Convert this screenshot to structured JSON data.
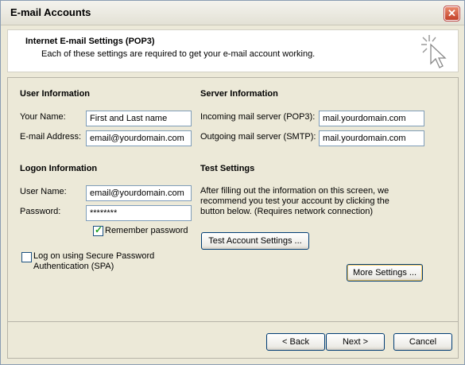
{
  "window": {
    "title": "E-mail Accounts"
  },
  "header": {
    "title": "Internet E-mail Settings (POP3)",
    "subtitle": "Each of these settings are required to get your e-mail account working."
  },
  "user_info": {
    "heading": "User Information",
    "name_label": "Your Name:",
    "name_value": "First and Last name",
    "email_label": "E-mail Address:",
    "email_value": "email@yourdomain.com"
  },
  "server_info": {
    "heading": "Server Information",
    "incoming_label": "Incoming mail server (POP3):",
    "incoming_value": "mail.yourdomain.com",
    "outgoing_label": "Outgoing mail server (SMTP):",
    "outgoing_value": "mail.yourdomain.com"
  },
  "logon_info": {
    "heading": "Logon Information",
    "username_label": "User Name:",
    "username_value": "email@yourdomain.com",
    "password_label": "Password:",
    "password_value": "********",
    "remember_label": "Remember password",
    "remember_checked": true,
    "spa_line1": "Log on using Secure Password",
    "spa_line2": "Authentication (SPA)",
    "spa_checked": false
  },
  "test_settings": {
    "heading": "Test Settings",
    "description_line1": "After filling out the information on this screen, we",
    "description_line2": "recommend you test your account by clicking the",
    "description_line3": "button below. (Requires network connection)",
    "test_button": "Test Account Settings ..."
  },
  "more_settings_button": "More Settings ...",
  "footer": {
    "back_button": "< Back",
    "next_button": "Next >",
    "cancel_button": "Cancel"
  },
  "icons": {
    "close": "close-icon",
    "cursor": "cursor-sparkle-icon",
    "check": "checkmark-icon"
  },
  "colors": {
    "dialog_bg": "#ece9d8",
    "field_border": "#7f9db9",
    "button_border": "#003c74",
    "close_red": "#c3412a",
    "check_green": "#21a121"
  }
}
